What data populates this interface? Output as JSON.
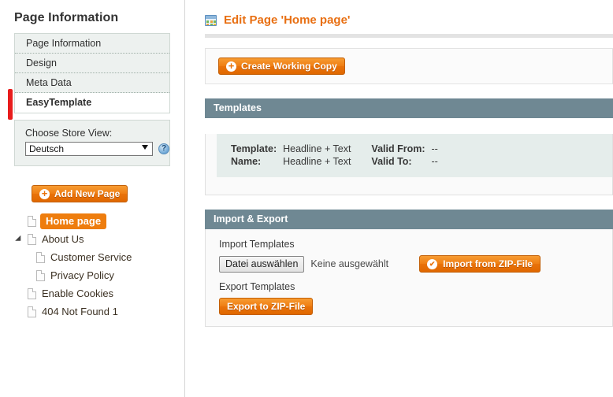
{
  "sidebar": {
    "title": "Page Information",
    "tabs": [
      {
        "label": "Page Information",
        "selected": false
      },
      {
        "label": "Design",
        "selected": false
      },
      {
        "label": "Meta Data",
        "selected": false
      },
      {
        "label": "EasyTemplate",
        "selected": true
      }
    ],
    "store_view": {
      "label": "Choose Store View:",
      "selected": "Deutsch",
      "options": [
        "Deutsch"
      ],
      "help_glyph": "?"
    },
    "add_new_page_label": "Add New Page",
    "tree": [
      {
        "label": "Home page",
        "level": 0,
        "active": true,
        "arrow": false
      },
      {
        "label": "About Us",
        "level": 0,
        "active": false,
        "arrow": true
      },
      {
        "label": "Customer Service",
        "level": 1,
        "active": false,
        "arrow": false
      },
      {
        "label": "Privacy Policy",
        "level": 1,
        "active": false,
        "arrow": false
      },
      {
        "label": "Enable Cookies",
        "level": 0,
        "active": false,
        "arrow": false
      },
      {
        "label": "404 Not Found 1",
        "level": 0,
        "active": false,
        "arrow": false
      }
    ]
  },
  "content": {
    "title": "Edit Page 'Home page'",
    "create_working_copy_label": "Create Working Copy",
    "templates_panel": {
      "heading": "Templates",
      "rows": [
        {
          "k1": "Template:",
          "v1": "Headline + Text",
          "k2": "Valid From:",
          "v2": "--"
        },
        {
          "k1": "Name:",
          "v1": "Headline + Text",
          "k2": "Valid To:",
          "v2": "--"
        }
      ]
    },
    "import_export_panel": {
      "heading": "Import & Export",
      "import_label": "Import Templates",
      "file_button_label": "Datei auswählen",
      "file_status": "Keine ausgewählt",
      "import_button_label": "Import from ZIP-File",
      "export_label": "Export Templates",
      "export_button_label": "Export to ZIP-File"
    }
  },
  "colors": {
    "accent_orange": "#ee7d0e",
    "panel_header": "#6f8893",
    "panel_inner": "#e5edeb",
    "marker_red": "#e81c1c"
  }
}
